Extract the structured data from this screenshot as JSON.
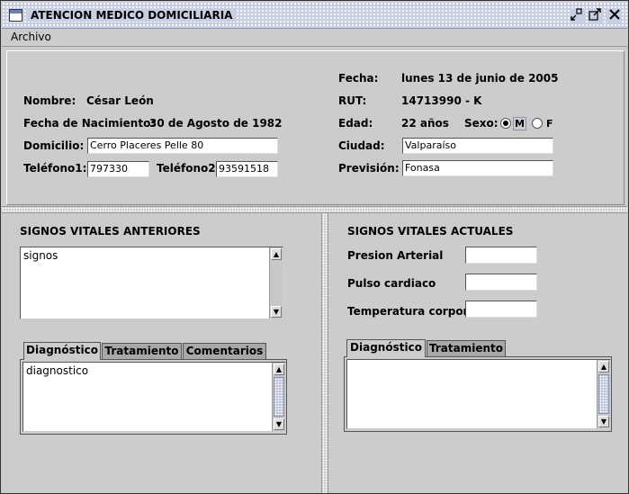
{
  "window": {
    "title": "ATENCION MEDICO DOMICILIARIA",
    "icon": "window-icon",
    "controls": [
      "minimize-icon",
      "maximize-icon",
      "close-icon"
    ]
  },
  "menubar": {
    "items": [
      {
        "label": "Archivo"
      }
    ]
  },
  "patient": {
    "fecha_label": "Fecha:",
    "fecha": "lunes 13 de junio de 2005",
    "nombre_label": "Nombre:",
    "nombre": "César León",
    "rut_label": "RUT:",
    "rut": "14713990 - K",
    "nacimiento_label": "Fecha de Nacimiento:",
    "nacimiento": "30 de Agosto de 1982",
    "edad_label": "Edad:",
    "edad": "22 años",
    "sexo_label": "Sexo:",
    "sexo_options": [
      {
        "label": "M",
        "selected": true
      },
      {
        "label": "F",
        "selected": false
      }
    ],
    "domicilio_label": "Domicilio:",
    "domicilio": "Cerro Placeres Pelle 80",
    "ciudad_label": "Ciudad:",
    "ciudad": "Valparaíso",
    "telefono1_label": "Teléfono1:",
    "telefono1": "797330",
    "telefono2_label": "Teléfono2:",
    "telefono2": "93591518",
    "prevision_label": "Previsión:",
    "prevision": "Fonasa"
  },
  "anteriores": {
    "title": "SIGNOS VITALES ANTERIORES",
    "signos_text": "signos",
    "tabs": [
      {
        "label": "Diagnóstico",
        "active": true
      },
      {
        "label": "Tratamiento",
        "active": false
      },
      {
        "label": "Comentarios",
        "active": false
      }
    ],
    "tab_text": "diagnostico"
  },
  "actuales": {
    "title": "SIGNOS VITALES ACTUALES",
    "fields": [
      {
        "label": "Presion Arterial",
        "value": ""
      },
      {
        "label": "Pulso cardiaco",
        "value": ""
      },
      {
        "label": "Temperatura corporal",
        "value": ""
      }
    ],
    "tabs": [
      {
        "label": "Diagnóstico",
        "active": true
      },
      {
        "label": "Tratamiento",
        "active": false
      }
    ],
    "tab_text": ""
  }
}
